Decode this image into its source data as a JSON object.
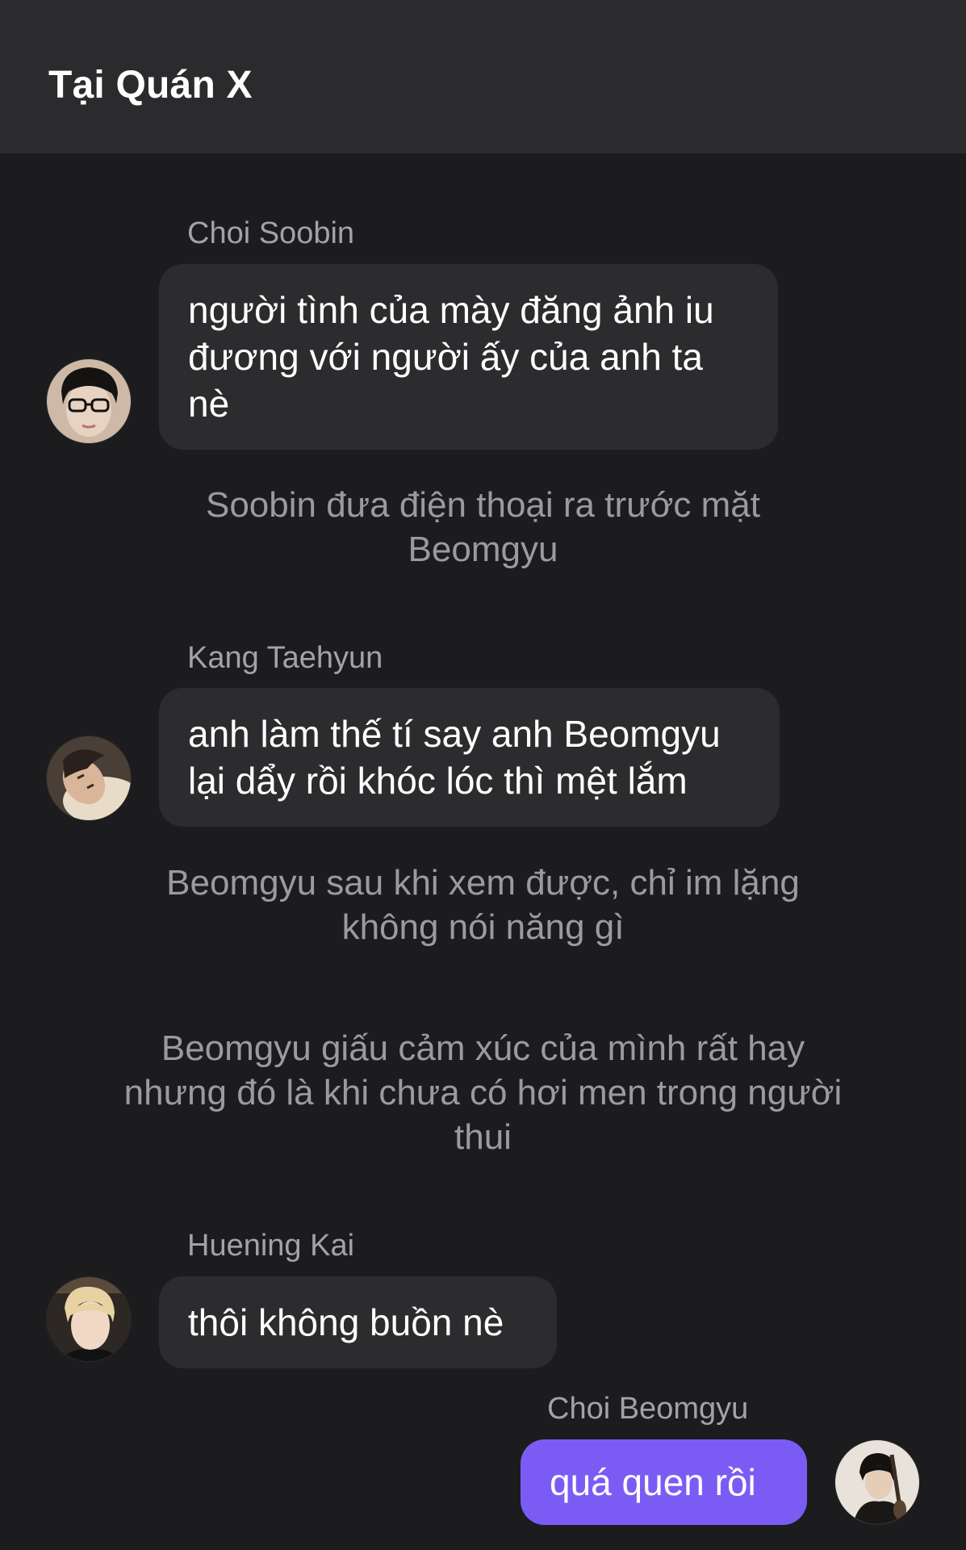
{
  "header": {
    "title": "Tại Quán X"
  },
  "messages": [
    {
      "sender": "Choi Soobin",
      "text": "người tình của mày đăng ảnh iu đương với người ấy của anh ta nè",
      "avatar_icon": "avatar-soobin-icon"
    },
    {
      "narration": "Soobin đưa điện thoại ra trước mặt Beomgyu"
    },
    {
      "sender": "Kang Taehyun",
      "text": "anh làm thế tí say anh Beomgyu lại dẩy rồi khóc lóc thì mệt lắm",
      "avatar_icon": "avatar-taehyun-icon"
    },
    {
      "narration": "Beomgyu sau khi xem được, chỉ im lặng không nói năng gì"
    },
    {
      "narration": "Beomgyu giấu cảm xúc của mình rất hay nhưng đó là khi chưa có hơi men trong người thui"
    },
    {
      "sender": "Huening Kai",
      "text": "thôi không buồn nè",
      "avatar_icon": "avatar-kai-icon"
    },
    {
      "sender": "Choi Beomgyu",
      "text": "quá quen rồi",
      "avatar_icon": "avatar-beomgyu-icon",
      "is_self": true
    }
  ],
  "colors": {
    "background": "#1c1c1e",
    "header": "#2b2b2d",
    "bubble_other": "#2c2c2e",
    "bubble_self": "#7a5cf5",
    "sender_name": "#a2a2a8",
    "narration": "#9a9aa0"
  }
}
